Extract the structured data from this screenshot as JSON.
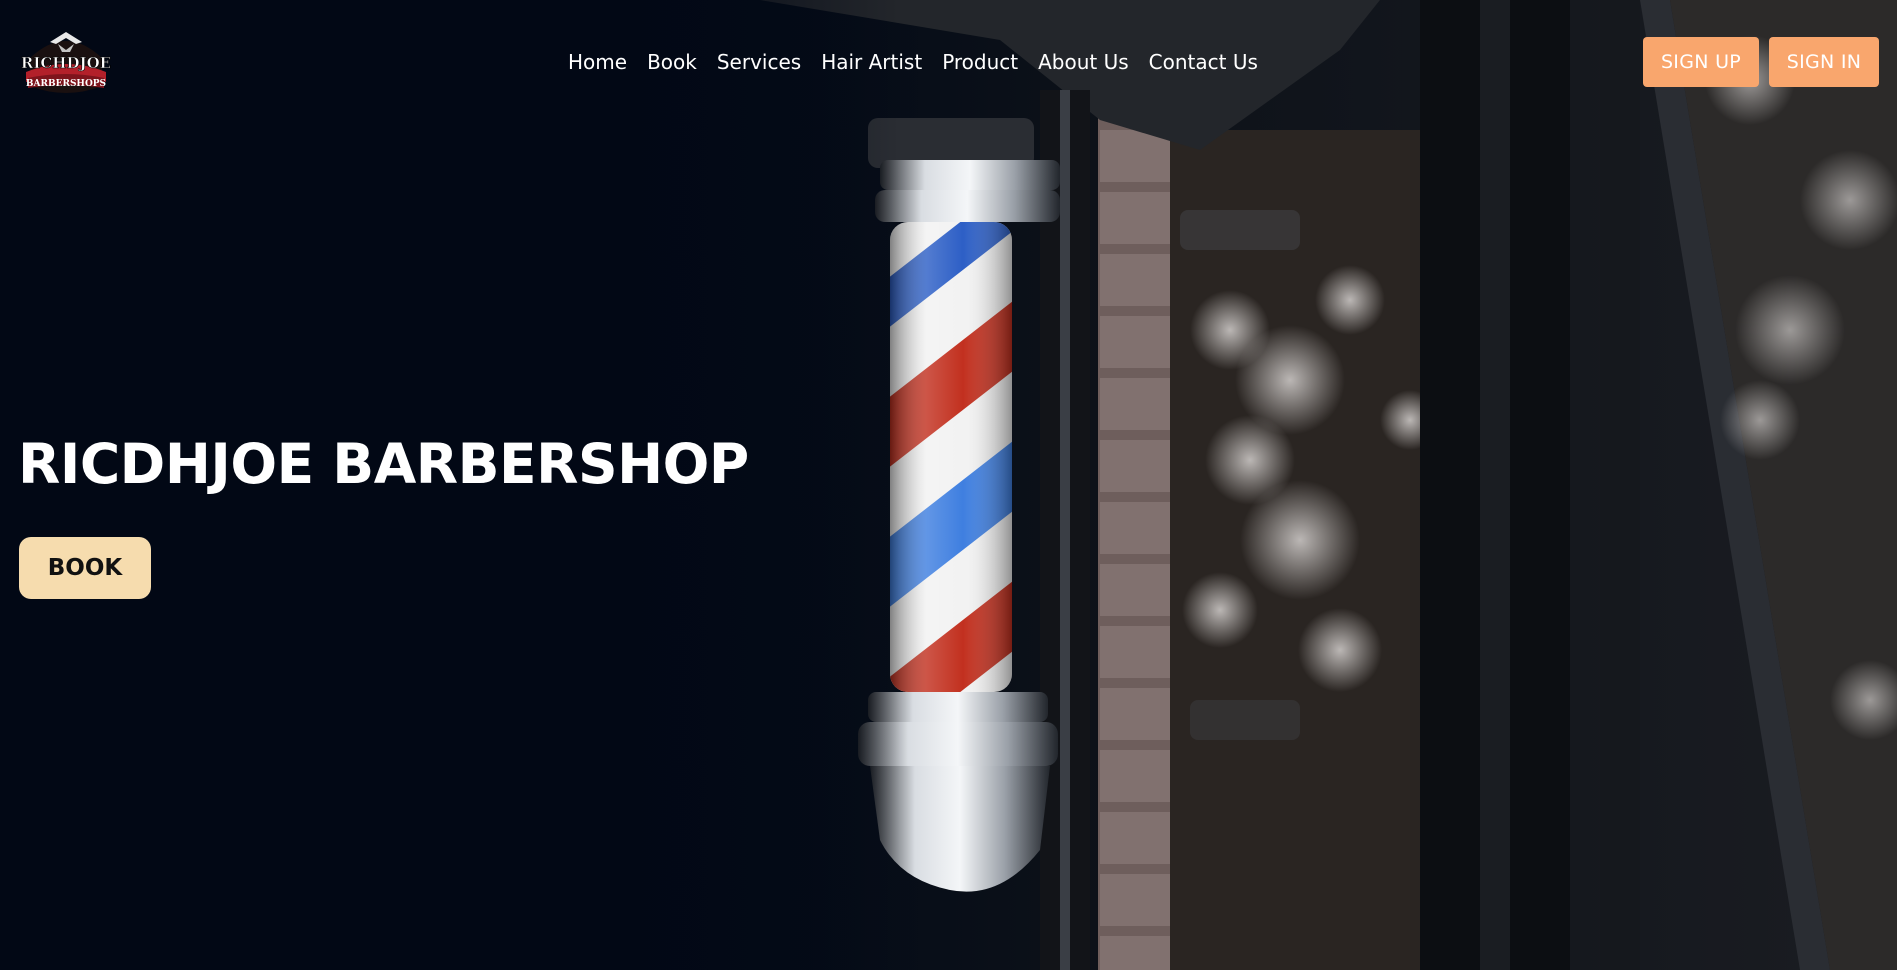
{
  "brand": {
    "logo_text_top": "RICHDJOE",
    "logo_text_bottom": "BARBERSHOPS",
    "logo_accent": "#b3202a"
  },
  "nav": {
    "items": [
      {
        "label": "Home"
      },
      {
        "label": "Book"
      },
      {
        "label": "Services"
      },
      {
        "label": "Hair Artist"
      },
      {
        "label": "Product"
      },
      {
        "label": "About Us"
      },
      {
        "label": "Contact Us"
      }
    ]
  },
  "auth": {
    "signup_label": "SIGN UP",
    "signin_label": "SIGN IN",
    "button_color": "#f9a66d"
  },
  "hero": {
    "title": "RICDHJOE BARBERSHOP",
    "book_label": "BOOK",
    "book_color": "#f6dcae",
    "image_subject": "barber-pole"
  }
}
